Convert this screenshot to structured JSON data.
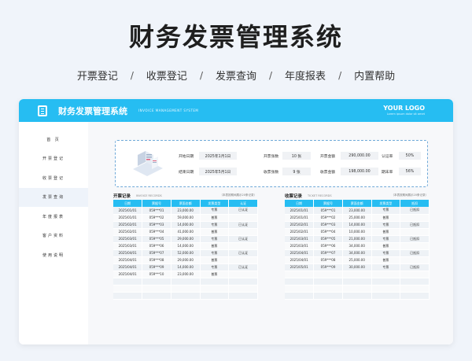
{
  "hero": {
    "title": "财务发票管理系统"
  },
  "nav": [
    "开票登记",
    "收票登记",
    "发票查询",
    "年度报表",
    "内置帮助"
  ],
  "nav_separator": "/",
  "app": {
    "title": "财务发票管理系统",
    "subtitle": "INVOICE MANAGEMENT SYSTEM",
    "logo": "YOUR LOGO",
    "logo_tagline": "Lorem ipsum dolor sit amet",
    "accent_color": "#26bdf2"
  },
  "sidebar": [
    "首 页",
    "开票登记",
    "收票登记",
    "发票查询",
    "年度报表",
    "客户资料",
    "使用说明"
  ],
  "summary": {
    "start_label": "开始日期",
    "start_value": "2025年1月1日",
    "end_label": "结束日期",
    "end_value": "2025年5月1日",
    "open_count_label": "开票张数",
    "open_count_value": "10 张",
    "open_amount_label": "开票金额",
    "open_amount_value": "290,000.00",
    "cert_rate_label": "认证率",
    "cert_rate_value": "50%",
    "recv_count_label": "收票张数",
    "recv_count_value": "9 张",
    "recv_amount_label": "收票金额",
    "recv_amount_value": "198,000.00",
    "period_rate_label": "期末率",
    "period_rate_value": "56%"
  },
  "open_records": {
    "title": "开票记录",
    "subtitle": "INVOICE RECORDS",
    "note": "（本表按期间展示20条记录）",
    "headers": [
      "日期",
      "票据号",
      "票面金额",
      "发票类型",
      "认证"
    ],
    "rows": [
      [
        "2025/01/01",
        "059***01",
        "23,000.00",
        "专票",
        "已认证"
      ],
      [
        "2025/01/01",
        "059***02",
        "59,000.00",
        "普票",
        ""
      ],
      [
        "2025/02/01",
        "059***03",
        "14,000.00",
        "专票",
        "已认证"
      ],
      [
        "2025/02/01",
        "059***04",
        "41,000.00",
        "普票",
        ""
      ],
      [
        "2025/03/01",
        "059***05",
        "29,000.00",
        "专票",
        "已认证"
      ],
      [
        "2025/03/01",
        "059***06",
        "14,000.00",
        "普票",
        ""
      ],
      [
        "2025/04/01",
        "059***07",
        "52,000.00",
        "专票",
        "已认证"
      ],
      [
        "2025/04/01",
        "059***08",
        "29,000.00",
        "普票",
        ""
      ],
      [
        "2025/04/01",
        "059***09",
        "14,000.00",
        "专票",
        "已认证"
      ],
      [
        "2025/04/01",
        "059***10",
        "23,000.00",
        "普票",
        ""
      ],
      [
        "",
        "",
        "",
        "",
        ""
      ],
      [
        "",
        "",
        "",
        "",
        ""
      ],
      [
        "",
        "",
        "",
        "",
        ""
      ]
    ]
  },
  "recv_records": {
    "title": "收票记录",
    "subtitle": "TICKET RECORDS",
    "note": "（本表按期间展示20条记录）",
    "headers": [
      "日期",
      "票据号",
      "票面金额",
      "发票类型",
      "抵扣"
    ],
    "rows": [
      [
        "2025/01/01",
        "059***01",
        "23,000.00",
        "专票",
        "已抵扣"
      ],
      [
        "2025/01/01",
        "059***02",
        "25,000.00",
        "普票",
        ""
      ],
      [
        "2025/02/01",
        "059***03",
        "14,000.00",
        "专票",
        "已抵扣"
      ],
      [
        "2025/02/01",
        "059***04",
        "10,000.00",
        "普票",
        ""
      ],
      [
        "2025/03/01",
        "059***05",
        "21,000.00",
        "专票",
        "已抵扣"
      ],
      [
        "2025/03/01",
        "059***06",
        "34,000.00",
        "普票",
        ""
      ],
      [
        "2025/04/01",
        "059***07",
        "34,000.00",
        "专票",
        "已抵扣"
      ],
      [
        "2025/04/01",
        "059***08",
        "25,000.00",
        "普票",
        ""
      ],
      [
        "2025/05/01",
        "059***09",
        "30,000.00",
        "专票",
        "已抵扣"
      ],
      [
        "",
        "",
        "",
        "",
        ""
      ],
      [
        "",
        "",
        "",
        "",
        ""
      ],
      [
        "",
        "",
        "",
        "",
        ""
      ],
      [
        "",
        "",
        "",
        "",
        ""
      ]
    ]
  }
}
